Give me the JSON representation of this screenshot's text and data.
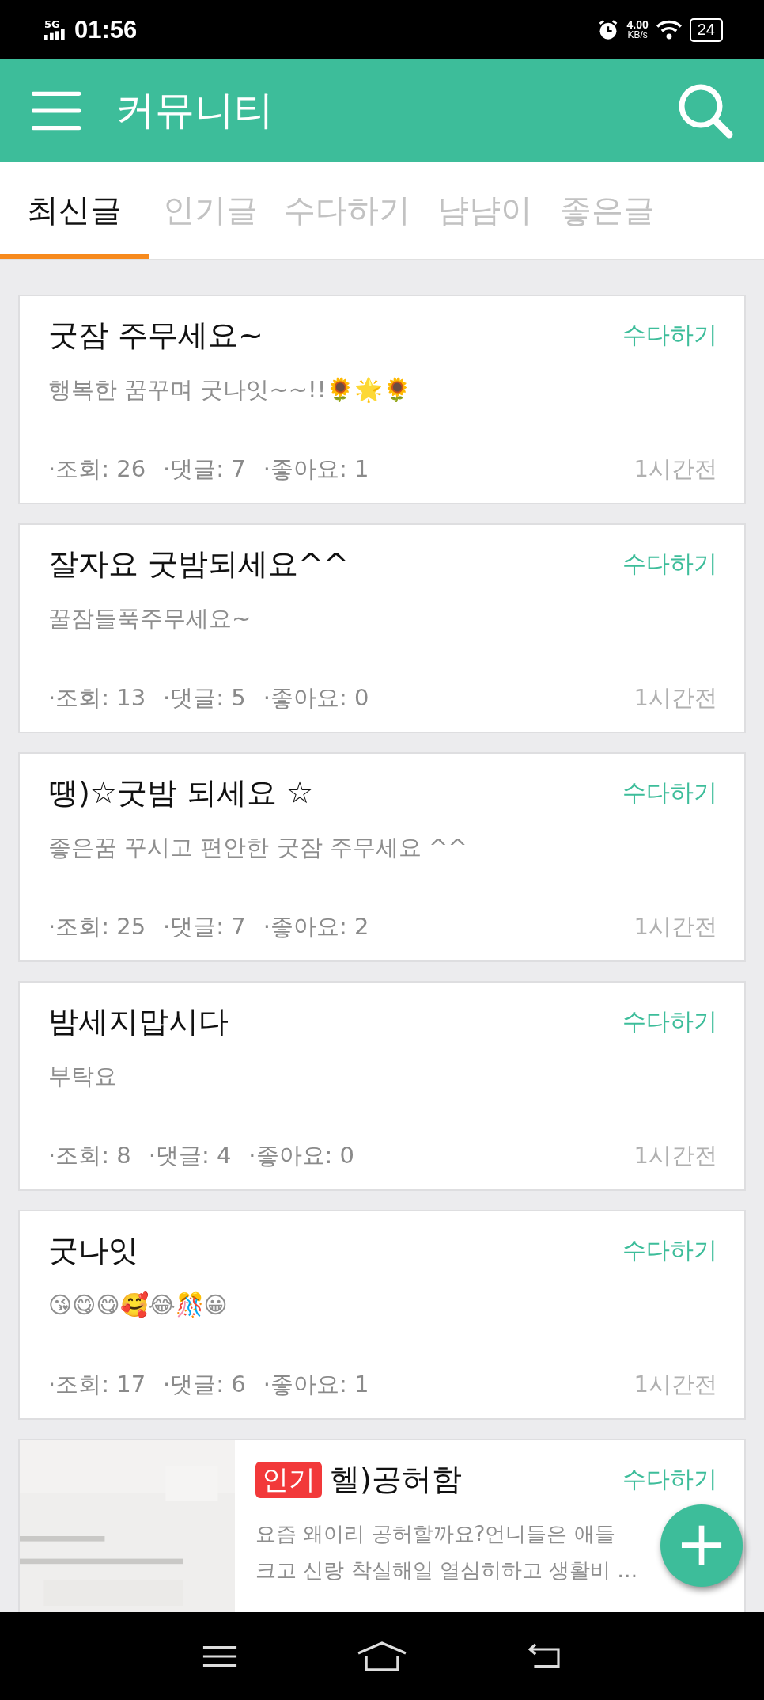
{
  "status_bar": {
    "network": "5G",
    "time": "01:56",
    "speed_value": "4.00",
    "speed_unit": "KB/s",
    "battery": "24"
  },
  "header": {
    "title": "커뮤니티"
  },
  "tabs": [
    {
      "label": "최신글",
      "selected": true
    },
    {
      "label": "인기글",
      "selected": false
    },
    {
      "label": "수다하기",
      "selected": false
    },
    {
      "label": "냠냠이",
      "selected": false
    },
    {
      "label": "좋은글",
      "selected": false
    }
  ],
  "posts": [
    {
      "title": "굿잠 주무세요~",
      "category": "수다하기",
      "body_lines": [
        "행복한 꿈꾸며 굿나잇~~!!🌻🌟🌻"
      ],
      "stats": [
        "·조회: 26",
        "·댓글: 7",
        "·좋아요: 1"
      ],
      "time": "1시간전"
    },
    {
      "title": "잘자요 굿밤되세요^^",
      "category": "수다하기",
      "body_lines": [
        "꿀잠들푹주무세요~"
      ],
      "stats": [
        "·조회: 13",
        "·댓글: 5",
        "·좋아요: 0"
      ],
      "time": "1시간전"
    },
    {
      "title": "땡)☆굿밤 되세요 ☆",
      "category": "수다하기",
      "body_lines": [
        "좋은꿈 꾸시고 편안한 굿잠 주무세요 ^^"
      ],
      "stats": [
        "·조회: 25",
        "·댓글: 7",
        "·좋아요: 2"
      ],
      "time": "1시간전"
    },
    {
      "title": "밤세지맙시다",
      "category": "수다하기",
      "body_lines": [
        "부탁요"
      ],
      "stats": [
        "·조회: 8",
        "·댓글: 4",
        "·좋아요: 0"
      ],
      "time": "1시간전"
    },
    {
      "title": "굿나잇",
      "category": "수다하기",
      "body_lines": [
        "😘😋😋🥰😂🎊😀"
      ],
      "stats": [
        "·조회: 17",
        "·댓글: 6",
        "·좋아요: 1"
      ],
      "time": "1시간전"
    },
    {
      "thumbnail": {
        "kind": "picture"
      },
      "badge": "인기",
      "title": "헬)공허함",
      "category": "수다하기",
      "body_lines": [
        "요즘 왜이리 공허할까요?언니들은 애들",
        "크고 신랑 착실해일 열심히하고 생활비 …"
      ]
    }
  ],
  "fab": {
    "label": "+"
  }
}
